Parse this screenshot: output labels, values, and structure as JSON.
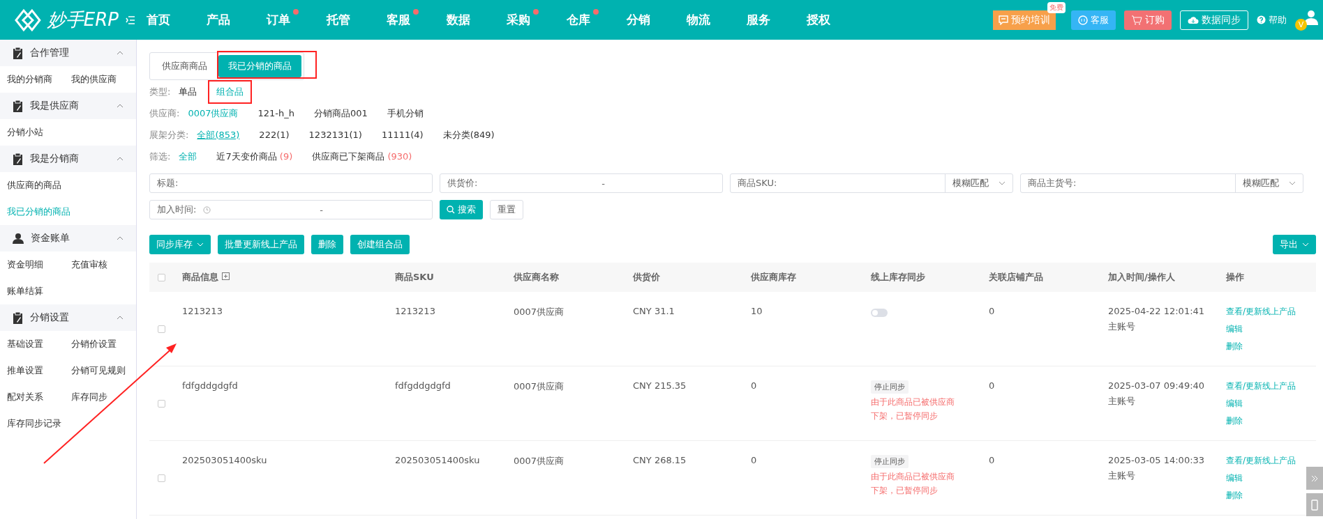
{
  "header": {
    "logo": "妙手ERP",
    "nav": [
      {
        "label": "首页",
        "dot": false
      },
      {
        "label": "产品",
        "dot": false
      },
      {
        "label": "订单",
        "dot": true
      },
      {
        "label": "托管",
        "dot": false
      },
      {
        "label": "客服",
        "dot": true
      },
      {
        "label": "数据",
        "dot": false
      },
      {
        "label": "采购",
        "dot": true
      },
      {
        "label": "仓库",
        "dot": true
      },
      {
        "label": "分销",
        "dot": false
      },
      {
        "label": "物流",
        "dot": false
      },
      {
        "label": "服务",
        "dot": false
      },
      {
        "label": "授权",
        "dot": false
      }
    ],
    "training": {
      "label": "预约培训",
      "badge": "免费"
    },
    "service": "客服",
    "order": "订购",
    "sync": "数据同步",
    "help": "帮助",
    "avatar_letter": "V"
  },
  "sidebar": [
    {
      "title": "合作管理",
      "expanded": true,
      "rows": [
        [
          {
            "label": "我的分销商",
            "selected": false
          },
          {
            "label": "我的供应商",
            "selected": false
          }
        ]
      ]
    },
    {
      "title": "我是供应商",
      "expanded": true,
      "rows": [
        [
          {
            "label": "分销小站",
            "selected": false
          }
        ]
      ]
    },
    {
      "title": "我是分销商",
      "expanded": true,
      "rows": [
        [
          {
            "label": "供应商的商品",
            "selected": false
          }
        ],
        [
          {
            "label": "我已分销的商品",
            "selected": true
          }
        ]
      ]
    },
    {
      "title": "资金账单",
      "expanded": true,
      "rows": [
        [
          {
            "label": "资金明细",
            "selected": false
          },
          {
            "label": "充值审核",
            "selected": false
          }
        ],
        [
          {
            "label": "账单结算",
            "selected": false
          }
        ]
      ]
    },
    {
      "title": "分销设置",
      "expanded": true,
      "rows": [
        [
          {
            "label": "基础设置",
            "selected": false
          },
          {
            "label": "分销价设置",
            "selected": false
          }
        ],
        [
          {
            "label": "推单设置",
            "selected": false
          },
          {
            "label": "分销可见规则",
            "selected": false
          }
        ],
        [
          {
            "label": "配对关系",
            "selected": false
          },
          {
            "label": "库存同步",
            "selected": false
          }
        ],
        [
          {
            "label": "库存同步记录",
            "selected": false
          }
        ]
      ]
    }
  ],
  "tabs": [
    {
      "label": "供应商商品",
      "selected": false,
      "highlighted": false
    },
    {
      "label": "我已分销的商品",
      "selected": true,
      "highlighted": true
    }
  ],
  "filters": [
    {
      "label": "类型:",
      "options": [
        {
          "label": "单品",
          "selected": false,
          "highlighted": false
        },
        {
          "label": "组合品",
          "selected": true,
          "highlighted": true
        }
      ]
    },
    {
      "label": "供应商:",
      "options": [
        {
          "label": "0007供应商",
          "selected": true,
          "highlighted": false
        },
        {
          "label": "121-h_h",
          "selected": false,
          "highlighted": false
        },
        {
          "label": "分销商品001",
          "selected": false,
          "highlighted": false
        },
        {
          "label": "手机分销",
          "selected": false,
          "highlighted": false
        }
      ]
    },
    {
      "label": "展架分类:",
      "options": [
        {
          "label": "全部(853)",
          "selected": true,
          "highlighted": false
        },
        {
          "label": "222(1)",
          "selected": false,
          "highlighted": false
        },
        {
          "label": "1232131(1)",
          "selected": false,
          "highlighted": false
        },
        {
          "label": "11111(4)",
          "selected": false,
          "highlighted": false
        },
        {
          "label": "未分类(849)",
          "selected": false,
          "highlighted": false
        }
      ]
    },
    {
      "label": "筛选:",
      "options": [
        {
          "label": "全部",
          "selected": true,
          "highlighted": false
        },
        {
          "label": "近7天变价商品",
          "count": "(9)",
          "selected": false,
          "highlighted": false
        },
        {
          "label": "供应商已下架商品",
          "count": "(930)",
          "selected": false,
          "highlighted": false
        }
      ]
    }
  ],
  "search_fields": [
    [
      {
        "kind": "text",
        "label": "标题:"
      },
      {
        "kind": "range",
        "label": "供货价:",
        "separator": "-"
      },
      {
        "kind": "match",
        "label": "商品SKU:",
        "match": "模糊匹配"
      },
      {
        "kind": "match",
        "label": "商品主货号:",
        "match": "模糊匹配"
      }
    ],
    [
      {
        "kind": "date",
        "label": "加入时间:",
        "separator": "-"
      }
    ]
  ],
  "search_button": "搜索",
  "reset_button": "重置",
  "actions": [
    {
      "label": "同步库存",
      "dropdown": true
    },
    {
      "label": "批量更新线上产品",
      "dropdown": false
    },
    {
      "label": "删除",
      "dropdown": false
    },
    {
      "label": "创建组合品",
      "dropdown": false
    }
  ],
  "export_button": "导出",
  "table": {
    "all_checked": false,
    "columns": [
      "商品信息",
      "商品SKU",
      "供应商名称",
      "供货价",
      "供应商库存",
      "线上库存同步",
      "关联店铺产品",
      "加入时间/操作人",
      "操作"
    ],
    "rows": [
      {
        "checked": false,
        "info": "1213213",
        "sku": "1213213",
        "supplier": "0007供应商",
        "price": "CNY 31.1",
        "stock": "10",
        "sync": {
          "kind": "toggle",
          "on": false
        },
        "linked": "0",
        "time": "2025-04-22 12:01:41",
        "operator": "主账号",
        "actions": [
          "查看/更新线上产品",
          "编辑",
          "删除"
        ]
      },
      {
        "checked": false,
        "info": "fdfgddgdgfd",
        "sku": "fdfgddgdgfd",
        "supplier": "0007供应商",
        "price": "CNY 215.35",
        "stock": "0",
        "sync": {
          "kind": "stopped",
          "tag": "停止同步",
          "note": "由于此商品已被供应商下架，已暂停同步"
        },
        "linked": "0",
        "time": "2025-03-07 09:49:40",
        "operator": "主账号",
        "actions": [
          "查看/更新线上产品",
          "编辑",
          "删除"
        ]
      },
      {
        "checked": false,
        "info": "202503051400sku",
        "sku": "202503051400sku",
        "supplier": "0007供应商",
        "price": "CNY 268.15",
        "stock": "0",
        "sync": {
          "kind": "stopped",
          "tag": "停止同步",
          "note": "由于此商品已被供应商下架，已暂停同步"
        },
        "linked": "0",
        "time": "2025-03-05 14:00:33",
        "operator": "主账号",
        "actions": [
          "查看/更新线上产品",
          "编辑",
          "删除"
        ]
      }
    ]
  }
}
